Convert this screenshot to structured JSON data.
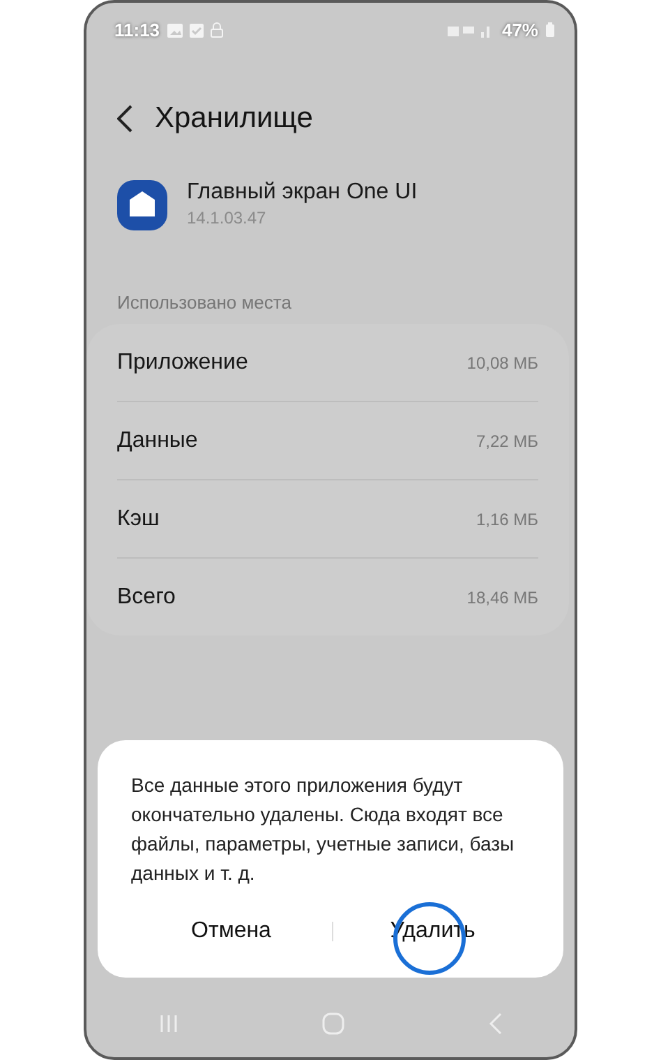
{
  "status_bar": {
    "time": "11:13",
    "battery": "47%"
  },
  "header": {
    "title": "Хранилище"
  },
  "app": {
    "name": "Главный экран One UI",
    "version": "14.1.03.47"
  },
  "section": {
    "label": "Использовано места"
  },
  "storage_rows": [
    {
      "label": "Приложение",
      "value": "10,08 МБ"
    },
    {
      "label": "Данные",
      "value": "7,22 МБ"
    },
    {
      "label": "Кэш",
      "value": "1,16 МБ"
    },
    {
      "label": "Всего",
      "value": "18,46 МБ"
    }
  ],
  "dialog": {
    "message": "Все данные этого приложения будут окончательно удалены. Сюда входят все файлы, параметры, учетные записи, базы данных и т. д.",
    "buttons": [
      {
        "label": "Отмена",
        "highlighted": false
      },
      {
        "label": "Удалить",
        "highlighted": true
      }
    ]
  }
}
